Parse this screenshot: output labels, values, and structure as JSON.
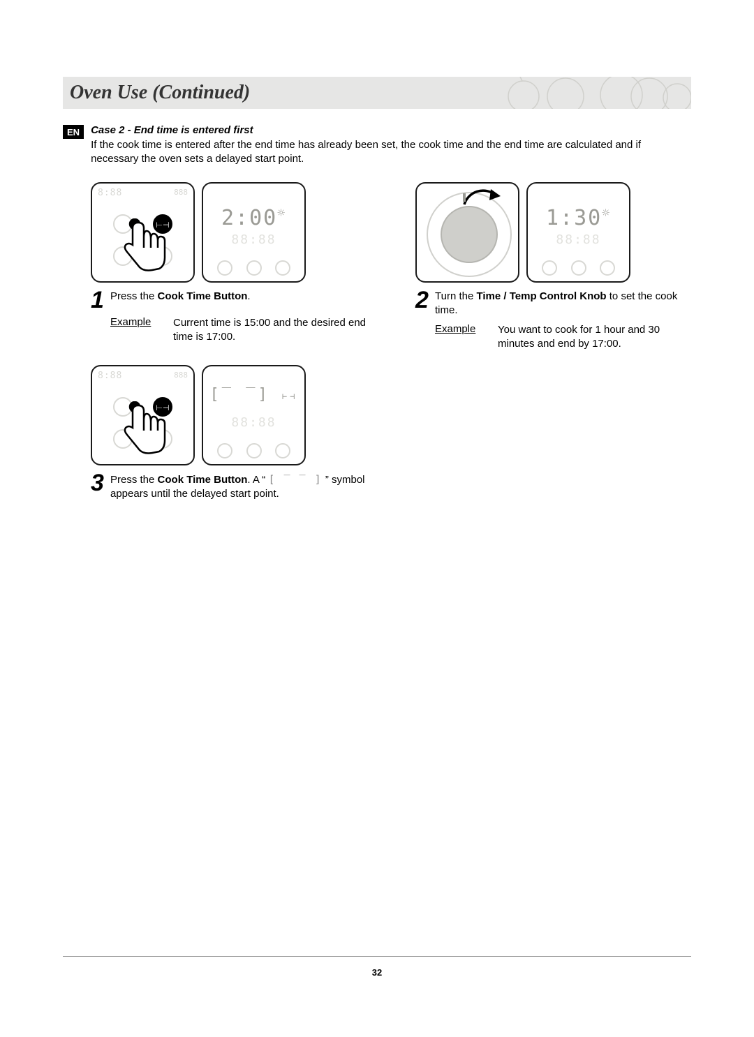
{
  "lang_badge": "EN",
  "title": "Oven Use (Continued)",
  "case_heading": "Case 2 - End time is entered first",
  "case_desc": "If the cook time is entered after the end time has already been set, the cook time and the end time are calculated and if necessary the oven sets a delayed start point.",
  "step1": {
    "num": "1",
    "display": "2:00",
    "text_a": "Press the ",
    "bold": "Cook Time Button",
    "text_b": ".",
    "example_label": "Example",
    "example_text": "Current time is 15:00 and the desired end time is 17:00."
  },
  "step2": {
    "num": "2",
    "display": "1:30",
    "text_a": "Turn the ",
    "bold": "Time / Temp Control Knob",
    "text_b": " to set the cook time.",
    "example_label": "Example",
    "example_text": "You want to cook for 1 hour and 30 minutes and end by 17:00."
  },
  "step3": {
    "num": "3",
    "display_symbol": "[ ‾ ‾ ]",
    "text_a": "Press the ",
    "bold": "Cook Time Button",
    "text_b": ". A “ ",
    "text_c": " ” symbol appears until the delayed start point."
  },
  "page_number": "32"
}
